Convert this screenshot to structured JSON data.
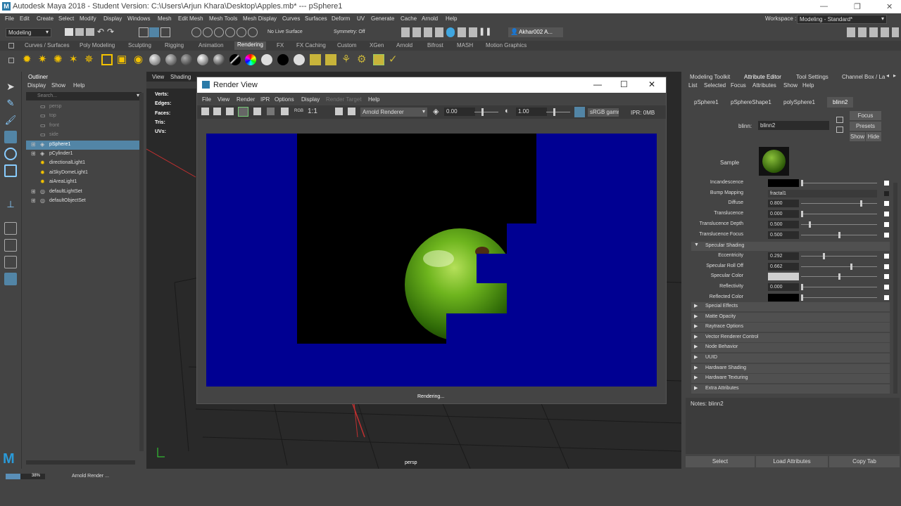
{
  "app": {
    "title": "Autodesk Maya 2018 - Student Version: C:\\Users\\Arjun Khara\\Desktop\\Apples.mb*   ---   pSphere1",
    "menus": [
      "File",
      "Edit",
      "Create",
      "Select",
      "Modify",
      "Display",
      "Windows",
      "Mesh",
      "Edit Mesh",
      "Mesh Tools",
      "Mesh Display",
      "Curves",
      "Surfaces",
      "Deform",
      "UV",
      "Generate",
      "Cache",
      "Arnold",
      "Help"
    ],
    "workspace_label": "Workspace :",
    "workspace_value": "Modeling - Standard*"
  },
  "statusline": {
    "mode": "Modeling",
    "live_surface": "No Live Surface",
    "symmetry": "Symmetry: Off",
    "user": "Akhar002 A..."
  },
  "shelf": {
    "tabs": [
      "Curves / Surfaces",
      "Poly Modeling",
      "Sculpting",
      "Rigging",
      "Animation",
      "Rendering",
      "FX",
      "FX Caching",
      "Custom",
      "XGen",
      "Arnold",
      "Bifrost",
      "MASH",
      "Motion Graphics"
    ],
    "active_tab": "Rendering"
  },
  "outliner": {
    "title": "Outliner",
    "menus": [
      "Display",
      "Show",
      "Help"
    ],
    "search_placeholder": "Search...",
    "items": [
      {
        "label": "persp",
        "dim": true
      },
      {
        "label": "top",
        "dim": true
      },
      {
        "label": "front",
        "dim": true
      },
      {
        "label": "side",
        "dim": true
      },
      {
        "label": "pSphere1",
        "selected": true
      },
      {
        "label": "pCylinder1"
      },
      {
        "label": "directionalLight1"
      },
      {
        "label": "aiSkyDomeLight1"
      },
      {
        "label": "aiAreaLight1"
      },
      {
        "label": "defaultLightSet"
      },
      {
        "label": "defaultObjectSet"
      }
    ]
  },
  "viewport": {
    "menus": [
      "View",
      "Shading"
    ],
    "hud": [
      "Verts:",
      "Edges:",
      "Faces:",
      "Tris:",
      "UVs:"
    ],
    "camera": "persp"
  },
  "render_view": {
    "title": "Render View",
    "menus": [
      "File",
      "View",
      "Render",
      "IPR",
      "Options",
      "Display",
      "Render Target",
      "Help"
    ],
    "ratio": "1:1",
    "renderer": "Arnold Renderer",
    "exposure": "0.00",
    "gamma": "1.00",
    "colorspace": "sRGB gamm",
    "ipr": "IPR: 0MB",
    "status": "Rendering...",
    "colors": {
      "background": "#000092"
    }
  },
  "attribute_editor": {
    "tabs": [
      "Modeling Toolkit",
      "Attribute Editor",
      "Tool Settings",
      "Channel Box / La"
    ],
    "active_tab": "Attribute Editor",
    "menus": [
      "List",
      "Selected",
      "Focus",
      "Attributes",
      "Show",
      "Help"
    ],
    "node_tabs": [
      "pSphere1",
      "pSphereShape1",
      "polySphere1",
      "blinn2"
    ],
    "active_node": "blinn2",
    "node_type": "blinn:",
    "node_name": "blinn2",
    "focus": "Focus",
    "presets": "Presets",
    "show": "Show",
    "hide": "Hide",
    "sample": "Sample",
    "rows": [
      {
        "label": "Incandescence",
        "value": "",
        "swatch": "#000",
        "slider": 0
      },
      {
        "label": "Bump Mapping",
        "value": "fractal1",
        "wide": true
      },
      {
        "label": "Diffuse",
        "value": "0.800",
        "slider": 0.8
      },
      {
        "label": "Translucence",
        "value": "0.000",
        "slider": 0
      },
      {
        "label": "Translucence Depth",
        "value": "0.500",
        "slider": 0.1
      },
      {
        "label": "Translucence Focus",
        "value": "0.500",
        "slider": 0.5
      }
    ],
    "specular_section": "Specular Shading",
    "spec_rows": [
      {
        "label": "Eccentricity",
        "value": "0.292",
        "slider": 0.292
      },
      {
        "label": "Specular Roll Off",
        "value": "0.662",
        "slider": 0.662
      },
      {
        "label": "Specular Color",
        "value": "",
        "swatch": "#cfcfcf",
        "slider": 0.5
      },
      {
        "label": "Reflectivity",
        "value": "0.000",
        "slider": 0
      },
      {
        "label": "Reflected Color",
        "value": "",
        "swatch": "#000",
        "slider": 0
      }
    ],
    "sections": [
      "Special Effects",
      "Matte Opacity",
      "Raytrace Options",
      "Vector Renderer Control",
      "Node Behavior",
      "UUID",
      "Hardware Shading",
      "Hardware Texturing",
      "Extra Attributes"
    ],
    "notes": "Notes:  blinn2",
    "buttons": [
      "Select",
      "Load Attributes",
      "Copy Tab"
    ]
  },
  "statusbar": {
    "progress": 0.38,
    "progress_text": "38%",
    "message": "Arnold Render ..."
  }
}
